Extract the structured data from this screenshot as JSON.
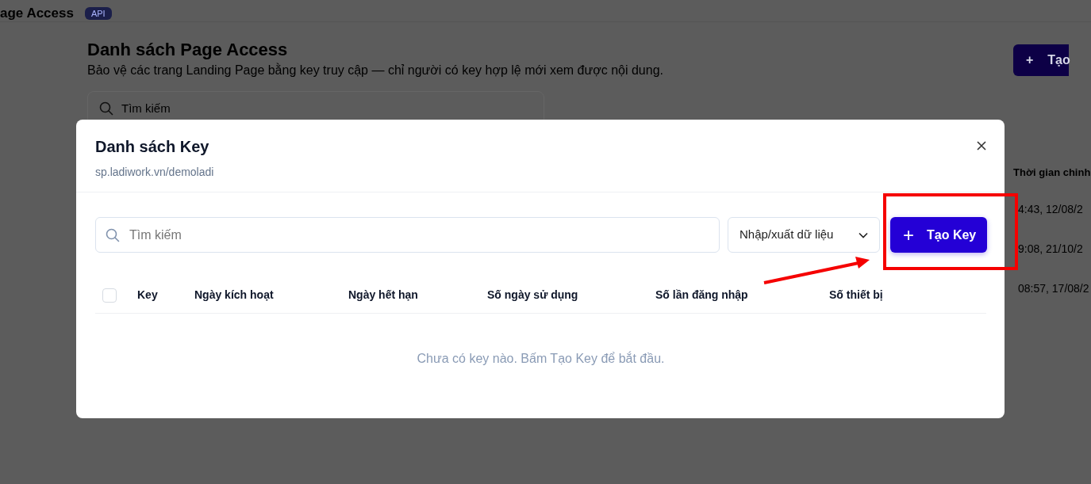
{
  "background_page": {
    "header": {
      "title": "age Access",
      "badge": "API"
    },
    "title": "Danh sách Page Access",
    "subtitle": "Bảo vệ các trang Landing Page bằng key truy cập — chỉ người có key hợp lệ mới xem được nội dung.",
    "search": {
      "placeholder": "Tìm kiếm"
    },
    "create_button": {
      "icon": "+",
      "label": "Tạo"
    },
    "table": {
      "column": "Thời gian chinh",
      "rows": [
        "4:43, 12/08/2",
        "9:08, 21/10/2",
        "08:57, 17/08/2"
      ]
    }
  },
  "modal": {
    "title": "Danh sách Key",
    "subtitle": "sp.ladiwork.vn/demoladi",
    "search": {
      "placeholder": "Tìm kiếm"
    },
    "import_export": {
      "label": "Nhập/xuất dữ liệu"
    },
    "create_button": {
      "icon": "+",
      "label": "Tạo Key"
    },
    "select_all": {
      "checked": false
    },
    "columns": [
      "Key",
      "Ngày kích hoạt",
      "Ngày hết hạn",
      "Số ngày sử dụng",
      "Số lần đăng nhập",
      "Số thiết bị"
    ],
    "empty_message": "Chưa có key nào. Bấm Tạo Key để bắt đầu."
  }
}
